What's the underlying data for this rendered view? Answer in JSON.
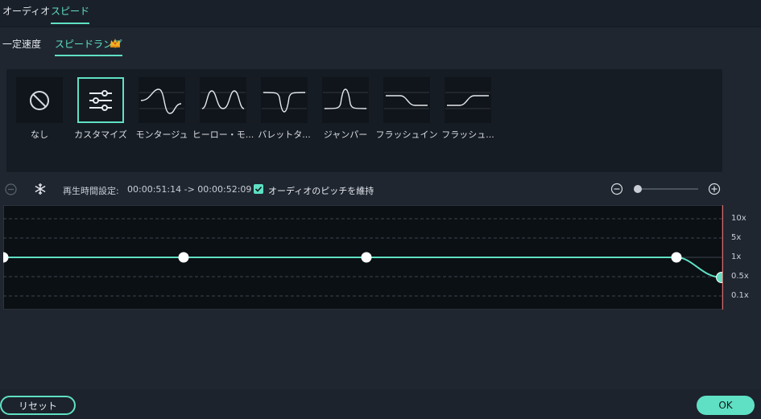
{
  "top_tabs": [
    {
      "label": "オーディオ",
      "active": false
    },
    {
      "label": "スピード",
      "active": true
    }
  ],
  "sub_tabs": [
    {
      "label": "一定速度",
      "active": false
    },
    {
      "label": "スピードランプ",
      "active": true
    }
  ],
  "presets": [
    {
      "label": "なし",
      "icon": "no-symbol-icon",
      "selected": false
    },
    {
      "label": "カスタマイズ",
      "icon": "sliders-icon",
      "selected": true
    },
    {
      "label": "モンタージュ",
      "icon": "montage-curve-icon",
      "selected": false
    },
    {
      "label": "ヒーロー・モ...",
      "icon": "hero-curve-icon",
      "selected": false
    },
    {
      "label": "バレットタ...",
      "icon": "bullet-curve-icon",
      "selected": false
    },
    {
      "label": "ジャンパー",
      "icon": "jumper-curve-icon",
      "selected": false
    },
    {
      "label": "フラッシュイン",
      "icon": "flash-in-curve-icon",
      "selected": false
    },
    {
      "label": "フラッシュ...",
      "icon": "flash-out-curve-icon",
      "selected": false
    }
  ],
  "toolbar": {
    "playback_label": "再生時間設定:",
    "playback_value": "00:00:51:14 -> 00:00:52:09",
    "pitch_label": "オーディオのピッチを維持",
    "pitch_checked": true
  },
  "graph": {
    "y_labels": [
      "10x",
      "5x",
      "1x",
      "0.5x",
      "0.1x"
    ],
    "points": [
      0,
      0.25,
      0.505,
      0.935,
      1.0
    ]
  },
  "buttons": {
    "reset": "リセット",
    "ok": "OK"
  },
  "colors": {
    "accent": "#5fe0c4",
    "background": "#1f2630",
    "playhead": "#e06666"
  }
}
